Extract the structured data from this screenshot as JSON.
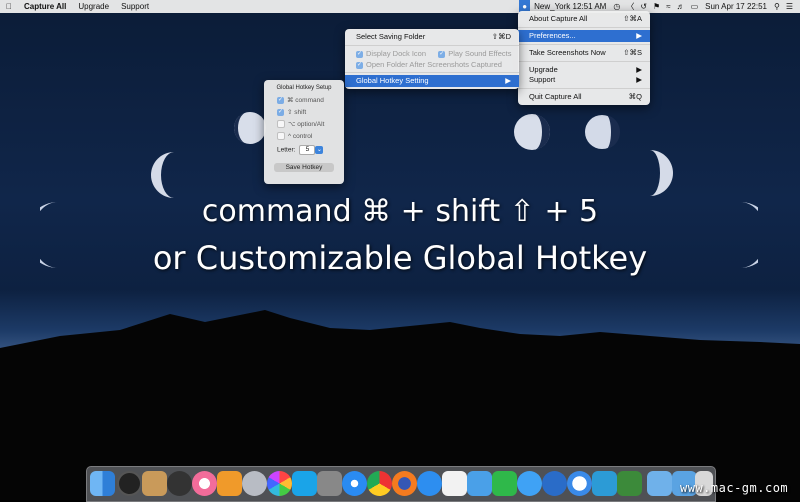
{
  "menubar": {
    "apple_icon": "apple-icon",
    "app_name": "Capture All",
    "menus": [
      "Upgrade",
      "Support"
    ],
    "status": {
      "clock_label": "New_York 12:51 AM",
      "date_time": "Sun Apr 17  22:51",
      "icons": [
        "capture-all-icon",
        "timer-icon",
        "cast-icon",
        "history-icon",
        "flag-icon",
        "wifi-icon",
        "volume-icon",
        "battery-icon",
        "search-icon",
        "list-icon"
      ]
    }
  },
  "main_menu": {
    "items": [
      {
        "label": "About Capture All",
        "shortcut": "⇧⌘A"
      },
      {
        "label": "Preferences...",
        "shortcut": "▶"
      },
      {
        "label": "Take Screenshots Now",
        "shortcut": "⇧⌘S"
      },
      {
        "label": "Upgrade",
        "shortcut": "▶"
      },
      {
        "label": "Support",
        "shortcut": "▶"
      },
      {
        "label": "Quit Capture All",
        "shortcut": "⌘Q"
      }
    ]
  },
  "pref_menu": {
    "select_folder": {
      "label": "Select Saving Folder",
      "shortcut": "⇧⌘D"
    },
    "display_dock_icon": "Display Dock Icon",
    "play_sound": "Play Sound Effects",
    "open_folder": "Open Folder After Screenshots Captured",
    "hotkey_setting": "Global Hotkey Setting",
    "hotkey_arrow": "▶"
  },
  "hotkey_panel": {
    "title": "Global Hotkey Setup",
    "command": "⌘ command",
    "shift": "⇧ shift",
    "option": "⌥ option/Alt",
    "control": "^ control",
    "letter_label": "Letter:",
    "letter_value": "5",
    "save_button": "Save Hotkey"
  },
  "headline": {
    "line1": "command ⌘ + shift ⇧ + 5",
    "line2": "or Customizable Global Hotkey"
  },
  "dock": {
    "icons": [
      "finder-icon",
      "dashboard-icon",
      "launchpad-icon",
      "zip-icon",
      "music-icon",
      "books-icon",
      "disk-icon",
      "photos-icon",
      "skype-icon",
      "preferences-icon",
      "safari-icon",
      "chrome-icon",
      "firefox-icon",
      "appstore-icon",
      "textedit-icon",
      "xcode-icon",
      "numbers-icon",
      "messages-icon",
      "hex-icon",
      "clock-icon",
      "dashboard-app-icon",
      "package-icon",
      "folder-icon",
      "downloads-icon",
      "trash-icon"
    ]
  },
  "watermark": "www.mac-gm.com",
  "colors": {
    "accent": "#2e6fd0",
    "menu_bg": "#eeeeee"
  }
}
